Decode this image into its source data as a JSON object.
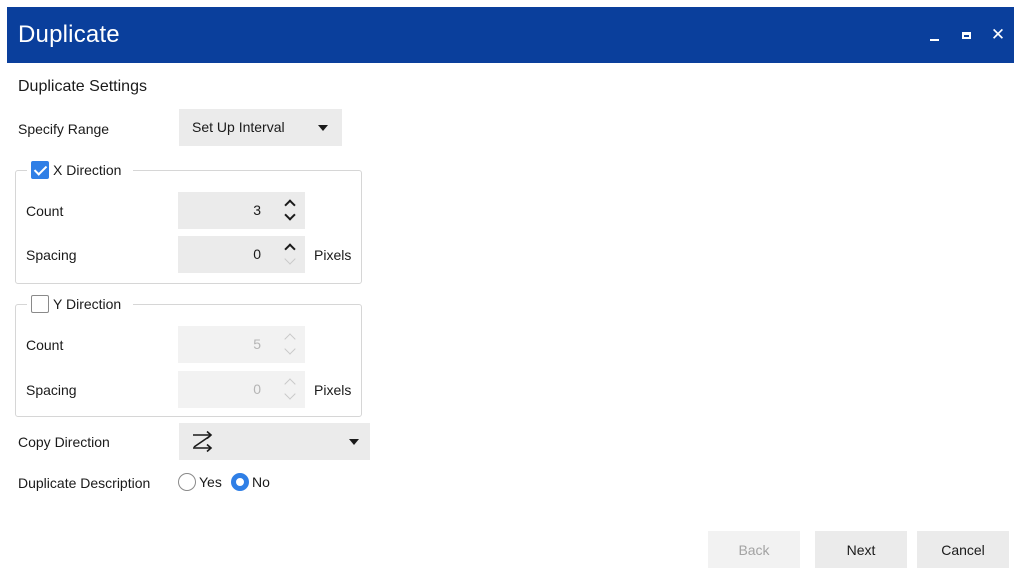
{
  "window": {
    "title": "Duplicate",
    "controls": [
      "minimize",
      "maximize",
      "close"
    ],
    "close_glyph": "✕"
  },
  "settings": {
    "section_title": "Duplicate Settings",
    "specify_range": {
      "label": "Specify Range",
      "value": "Set Up Interval"
    },
    "x_direction": {
      "label": "X Direction",
      "checked": true,
      "count_label": "Count",
      "count_value": "3",
      "spacing_label": "Spacing",
      "spacing_value": "0",
      "spacing_unit": "Pixels"
    },
    "y_direction": {
      "label": "Y Direction",
      "checked": false,
      "count_label": "Count",
      "count_value": "5",
      "spacing_label": "Spacing",
      "spacing_value": "0",
      "spacing_unit": "Pixels"
    },
    "copy_direction": {
      "label": "Copy Direction",
      "icon": "z-order-arrow-icon"
    },
    "duplicate_description": {
      "label": "Duplicate Description",
      "options": [
        "Yes",
        "No"
      ],
      "selected": "No"
    }
  },
  "footer": {
    "back_label": "Back",
    "next_label": "Next",
    "cancel_label": "Cancel"
  },
  "colors": {
    "titlebar": "#0a3f9c",
    "accent": "#2f7fe6",
    "field_bg": "#ebebeb"
  }
}
